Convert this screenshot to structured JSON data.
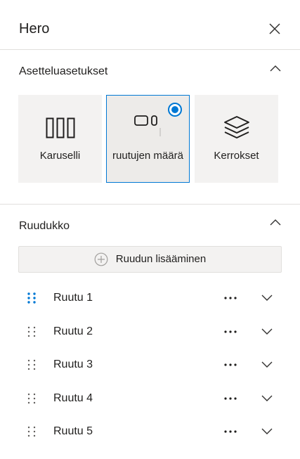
{
  "header": {
    "title": "Hero"
  },
  "layout_section": {
    "title": "Asetteluasetukset",
    "options": [
      {
        "label": "Karuselli",
        "icon": "carousel-icon"
      },
      {
        "label": "ruutujen määrä",
        "icon": "tiles-icon"
      },
      {
        "label": "Kerrokset",
        "icon": "layers-icon"
      }
    ],
    "selected_option": "ruutujen määrä"
  },
  "grid_section": {
    "title": "Ruudukko",
    "add_button_label": "Ruudun lisääminen",
    "tiles": [
      {
        "label": "Ruutu 1"
      },
      {
        "label": "Ruutu 2"
      },
      {
        "label": "Ruutu 3"
      },
      {
        "label": "Ruutu 4"
      },
      {
        "label": "Ruutu 5"
      }
    ]
  },
  "colors": {
    "accent": "#0078d4",
    "surface": "#f3f2f1",
    "divider": "#e1dfdd",
    "text": "#201f1e"
  }
}
